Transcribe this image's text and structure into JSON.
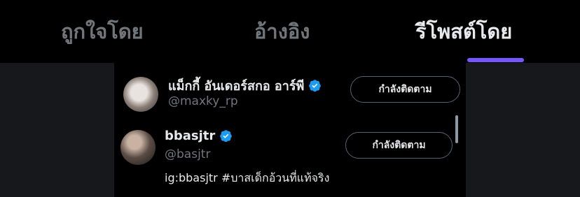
{
  "tabs": [
    {
      "label": "ถูกใจโดย",
      "active": false
    },
    {
      "label": "อ้างอิง",
      "active": false
    },
    {
      "label": "รีโพสต์โดย",
      "active": true
    }
  ],
  "accent_color": "#7856ff",
  "verified_color": "#1d9bf0",
  "users": [
    {
      "name": "แม็กกี้ อันเดอร์สกอ อาร์พี",
      "handle": "@maxky_rp",
      "button_label": "กำลังติดตาม",
      "verified": true
    },
    {
      "name": "bbasjtr",
      "handle": "@basjtr",
      "bio": "ig:bbasjtr #บาสเด็กอ้วนที่แท้จริง",
      "button_label": "กำลังติดตาม",
      "verified": true
    }
  ]
}
